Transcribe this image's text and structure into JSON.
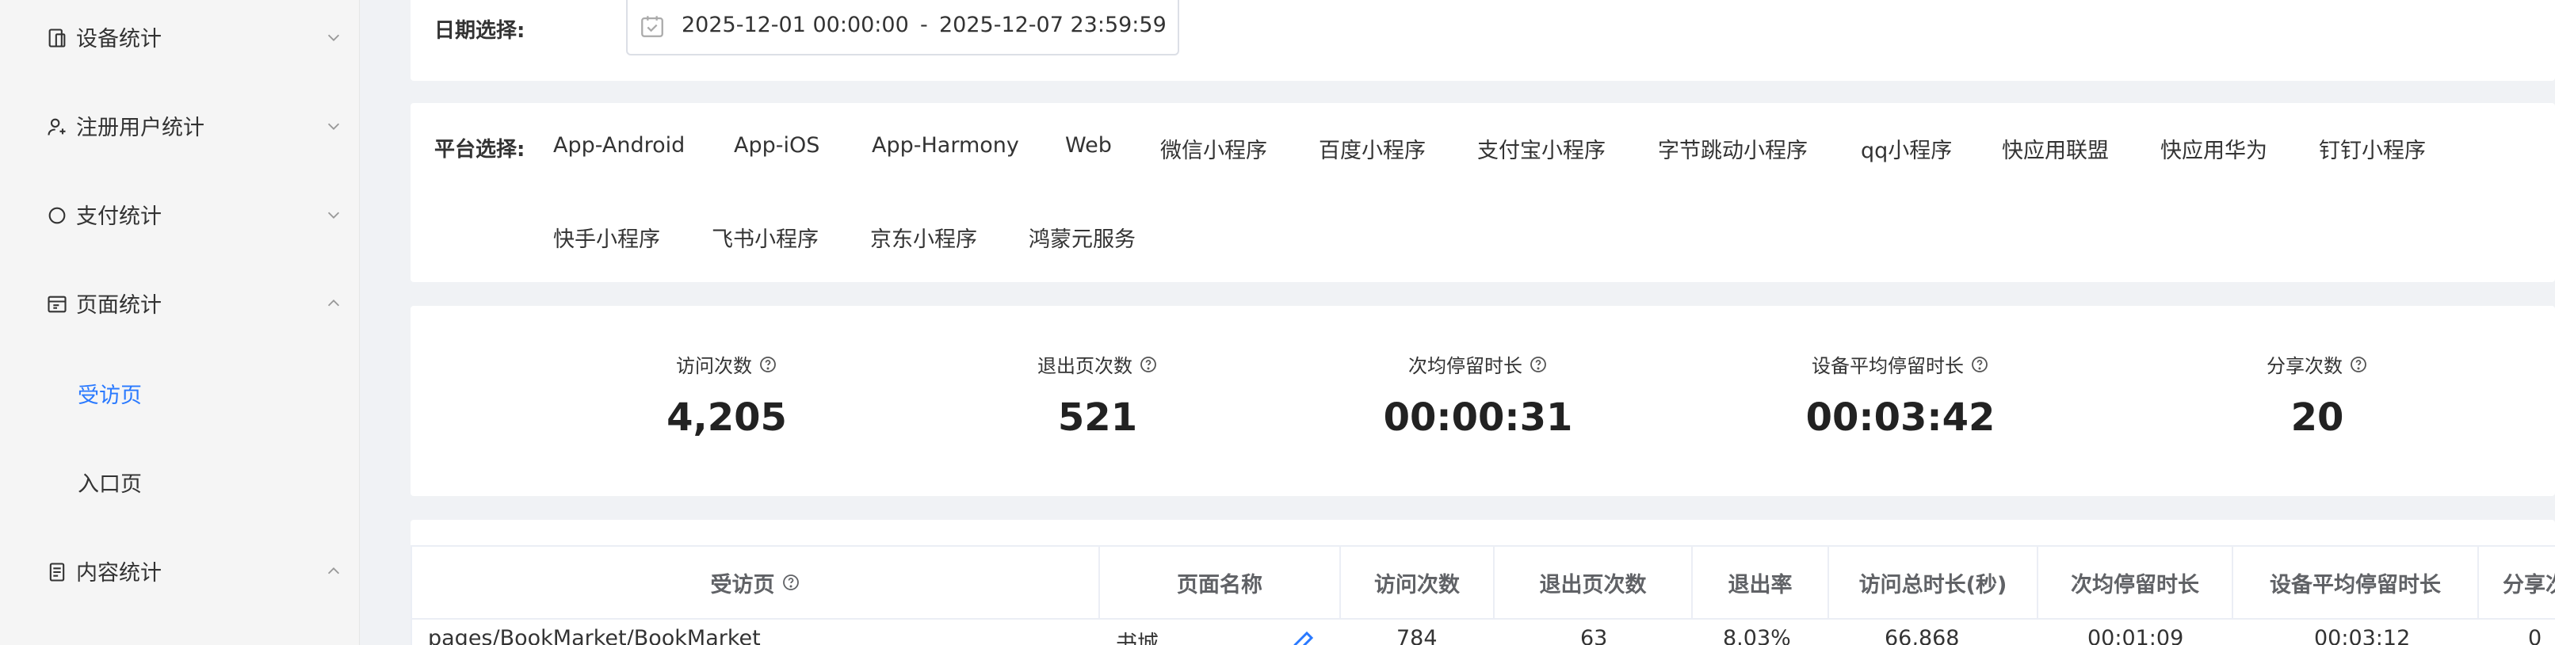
{
  "sidebar": {
    "items": [
      {
        "label": "设备统计",
        "icon": "device-icon",
        "expanded": false
      },
      {
        "label": "注册用户统计",
        "icon": "user-icon",
        "expanded": false
      },
      {
        "label": "支付统计",
        "icon": "circle-icon",
        "expanded": false
      },
      {
        "label": "页面统计",
        "icon": "page-icon",
        "expanded": true
      },
      {
        "label": "内容统计",
        "icon": "document-icon",
        "expanded": true
      }
    ],
    "sub_items": [
      {
        "label": "受访页",
        "active": true
      },
      {
        "label": "入口页",
        "active": false
      }
    ]
  },
  "date_filter": {
    "label": "日期选择:",
    "start": "2025-12-01 00:00:00",
    "separator": "-",
    "end": "2025-12-07 23:59:59"
  },
  "platform_filter": {
    "label": "平台选择:",
    "options": [
      "App-Android",
      "App-iOS",
      "App-Harmony",
      "Web",
      "微信小程序",
      "百度小程序",
      "支付宝小程序",
      "字节跳动小程序",
      "qq小程序",
      "快应用联盟",
      "快应用华为",
      "钉钉小程序",
      "快手小程序",
      "飞书小程序",
      "京东小程序",
      "鸿蒙元服务"
    ]
  },
  "stats": [
    {
      "label": "访问次数",
      "value": "4,205"
    },
    {
      "label": "退出页次数",
      "value": "521"
    },
    {
      "label": "次均停留时长",
      "value": "00:00:31"
    },
    {
      "label": "设备平均停留时长",
      "value": "00:03:42"
    },
    {
      "label": "分享次数",
      "value": "20"
    }
  ],
  "table": {
    "headers": [
      "受访页",
      "页面名称",
      "访问次数",
      "退出页次数",
      "退出率",
      "访问总时长(秒)",
      "次均停留时长",
      "设备平均停留时长",
      "分享次"
    ],
    "first_row": [
      "pages/BookMarket/BookMarket",
      "书城",
      "784",
      "63",
      "8.03%",
      "66,868",
      "00:01:09",
      "00:03:12",
      "0"
    ]
  },
  "colors": {
    "accent": "#2979ff",
    "text": "#333333",
    "border": "#ebeef5"
  }
}
